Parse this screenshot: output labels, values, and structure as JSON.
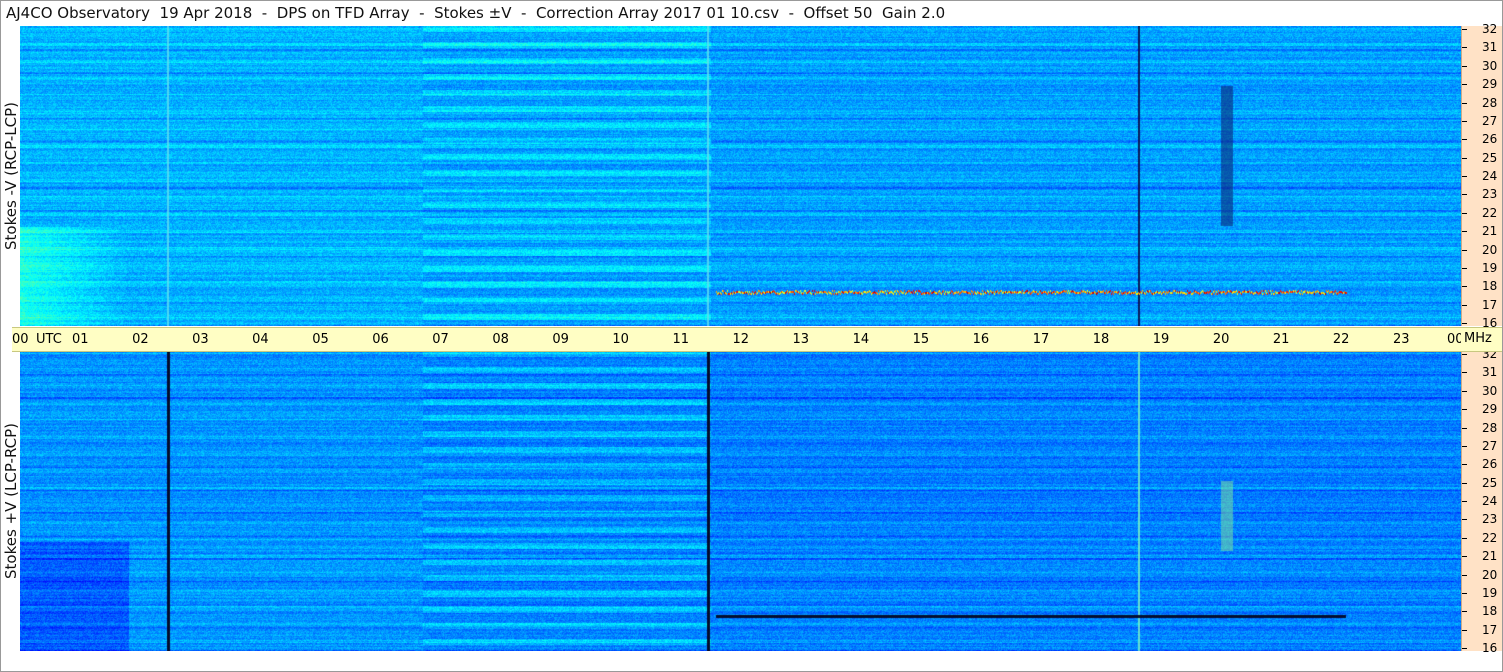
{
  "title": "AJ4CO Observatory  19 Apr 2018  -  DPS on TFD Array  -  Stokes ±V  -  Correction Array 2017 01 10.csv  -  Offset 50  Gain 2.0",
  "panels": [
    {
      "ylabel": "Stokes -V (RCP-LCP)"
    },
    {
      "ylabel": "Stokes +V (LCP-RCP)"
    }
  ],
  "x_axis": {
    "utc_label": "UTC",
    "unit_label": "MHz",
    "ticks": [
      "00",
      "01",
      "02",
      "03",
      "04",
      "05",
      "06",
      "07",
      "08",
      "09",
      "10",
      "11",
      "12",
      "13",
      "14",
      "15",
      "16",
      "17",
      "18",
      "19",
      "20",
      "21",
      "22",
      "23",
      "00"
    ]
  },
  "y_axis": {
    "ticks": [
      "32",
      "31",
      "30",
      "29",
      "28",
      "27",
      "26",
      "25",
      "24",
      "23",
      "22",
      "21",
      "20",
      "19",
      "18",
      "17",
      "16"
    ]
  },
  "colors": {
    "base_blue": "#1a63d6",
    "axis_time_bg": "#fffec4",
    "axis_freq_bg": "#ffe2c6"
  },
  "chart_data": {
    "type": "heatmap",
    "title": "AJ4CO Observatory  19 Apr 2018  -  DPS on TFD Array  -  Stokes ±V  -  Correction Array 2017 01 10.csv  -  Offset 50  Gain 2.0",
    "xlabel": "UTC",
    "ylabel_units": "MHz",
    "x_range_utc_hours": [
      0,
      24
    ],
    "y_range_mhz": [
      16,
      32
    ],
    "panels": [
      "Stokes -V (RCP-LCP)",
      "Stokes +V (LCP-RCP)"
    ],
    "colormap": "jet",
    "grid": false
  }
}
